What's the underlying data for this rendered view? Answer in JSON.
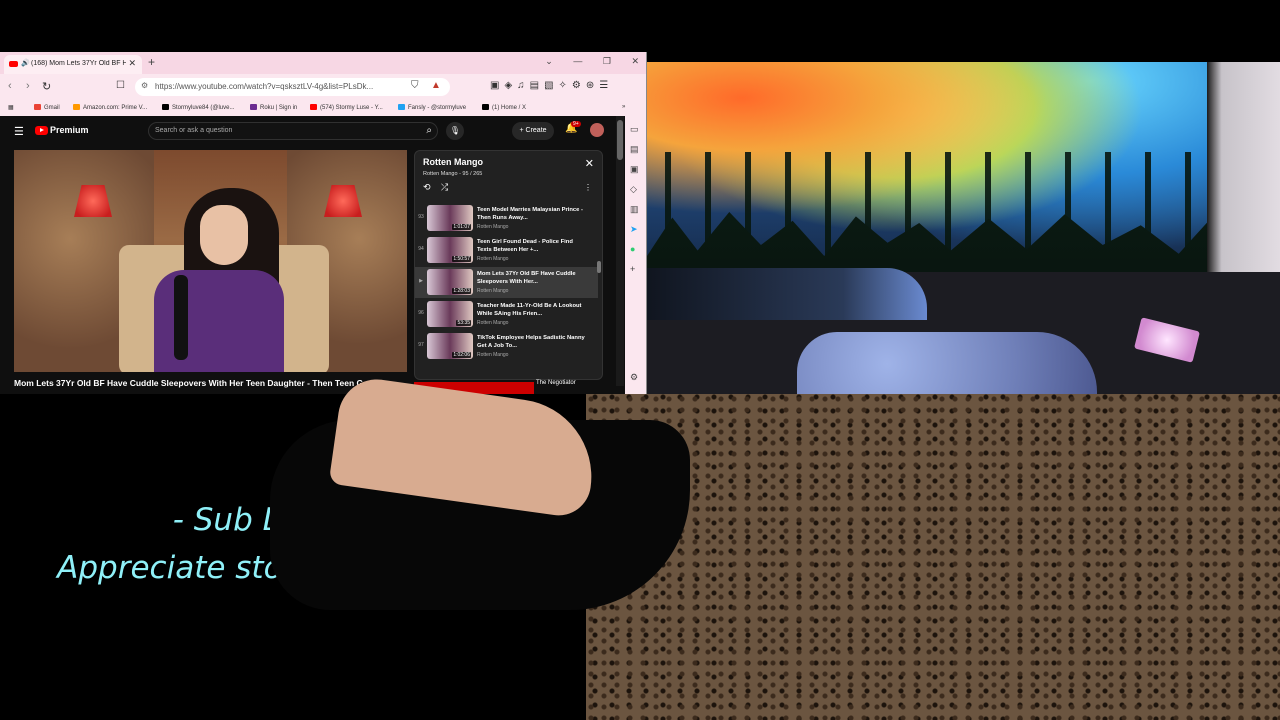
{
  "browser": {
    "tab_title": "(168) Mom Lets 37Yr Old BF Ha",
    "url": "https://www.youtube.com/watch?v=qsksztLV-4g&list=PLsDk...",
    "bookmarks": [
      {
        "label": "Gmail",
        "color": "#ea4335"
      },
      {
        "label": "Amazon.com: Prime V...",
        "color": "#ff9900"
      },
      {
        "label": "Stormyluve84 (@luve...",
        "color": "#000000"
      },
      {
        "label": "Roku | Sign in",
        "color": "#6c2c91"
      },
      {
        "label": "(574) Stormy Luse - Y...",
        "color": "#ff0000"
      },
      {
        "label": "Fansly - @stormyluve",
        "color": "#1fa2f2"
      },
      {
        "label": "(1) Home / X",
        "color": "#000000"
      }
    ]
  },
  "youtube": {
    "logo_text": "Premium",
    "search_placeholder": "Search or ask a question",
    "create_label": "Create",
    "notif_badge": "9+",
    "video_title": "Mom Lets 37Yr Old BF Have Cuddle Sleepovers With Her Teen Daughter - Then Teen Goes",
    "playlist": {
      "title": "Rotten Mango",
      "subtitle": "Rotten Mango - 95 / 265",
      "items": [
        {
          "num": "93",
          "title": "Teen Model Marries Malaysian Prince - Then Runs Away...",
          "channel": "Rotten Mango",
          "duration": "1:01:07",
          "active": false
        },
        {
          "num": "94",
          "title": "Teen Girl Found Dead - Police Find Texts Between Her +...",
          "channel": "Rotten Mango",
          "duration": "1:50:57",
          "active": false
        },
        {
          "num": "▶",
          "title": "Mom Lets 37Yr Old BF Have Cuddle Sleepovers With Her...",
          "channel": "Rotten Mango",
          "duration": "1:28:03",
          "active": true
        },
        {
          "num": "96",
          "title": "Teacher Made 11-Yr-Old Be A Lookout While SAing His Frien...",
          "channel": "Rotten Mango",
          "duration": "53:35",
          "active": false
        },
        {
          "num": "97",
          "title": "TikTok Employee Helps Sadistic Nanny Get A Job To...",
          "channel": "Rotten Mango",
          "duration": "1:02:06",
          "active": false
        }
      ]
    },
    "ad_title": "The Negotiator"
  },
  "overlay": {
    "line1": "- Sub Love -",
    "line2": "Appreciate stormys curves"
  },
  "colors": {
    "overlay_text": "#8ff0f8",
    "tab_bar": "#f7d7e4",
    "youtube_bg": "#0f0f0f"
  }
}
